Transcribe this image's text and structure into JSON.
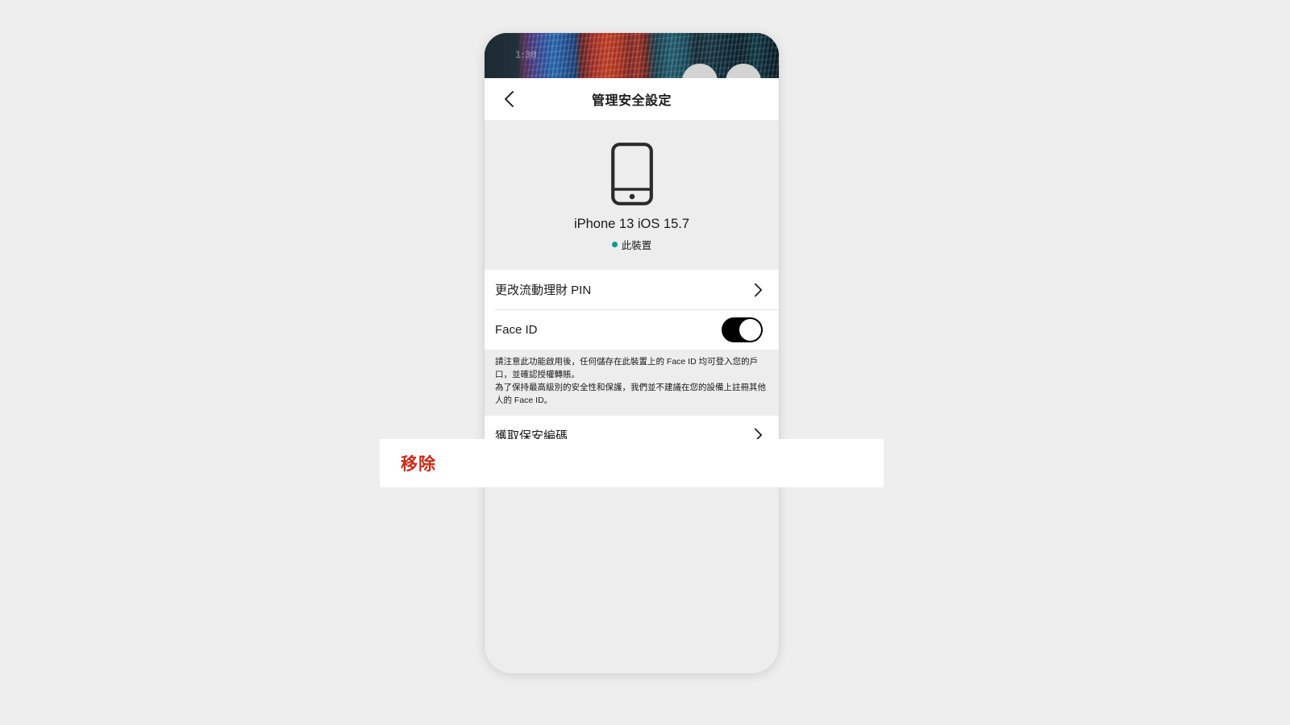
{
  "status_bar": {
    "time": "1:38"
  },
  "nav": {
    "back_icon": "chevron-left-icon",
    "title": "管理安全設定"
  },
  "device": {
    "icon": "mobile-phone-icon",
    "name": "iPhone 13 iOS 15.7",
    "status_label": "此裝置",
    "status_dot_color": "#009e8e"
  },
  "rows": [
    {
      "label": "更改流動理財 PIN",
      "accessory": "chevron-right-icon",
      "name": "row-change-mobile-banking-pin"
    },
    {
      "label": "Face ID",
      "accessory": "toggle-switch",
      "toggle_on": true,
      "name": "row-face-id"
    },
    {
      "label": "獲取保安編碼",
      "accessory": "chevron-right-icon",
      "name": "row-get-security-code"
    }
  ],
  "disclaimer": {
    "line1": "請注意此功能啟用後，任何儲存在此裝置上的 Face ID 均可登入您的戶口，並確認授權轉賬。",
    "line2": "為了保持最高級別的安全性和保護，我們並不建議在您的設備上註冊其他人的 Face ID。"
  },
  "overlay": {
    "remove_label": "移除",
    "remove_color": "#cf2817"
  },
  "colors": {
    "page_background": "#eeeeee",
    "card_background": "#ffffff",
    "section_background": "#ededed",
    "toggle_on": "#000000",
    "accent_teal": "#009e8e",
    "danger_red": "#cf2817"
  }
}
